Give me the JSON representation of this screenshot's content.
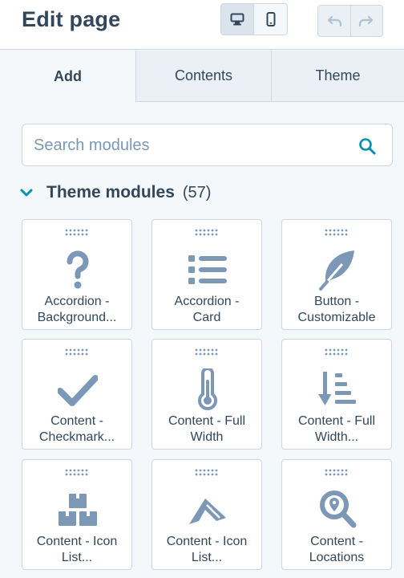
{
  "header": {
    "title": "Edit page",
    "view_toggle": [
      "desktop-icon",
      "mobile-icon"
    ],
    "history": [
      "undo-icon",
      "redo-icon"
    ]
  },
  "tabs": [
    {
      "label": "Add",
      "active": true
    },
    {
      "label": "Contents",
      "active": false
    },
    {
      "label": "Theme",
      "active": false
    }
  ],
  "search": {
    "placeholder": "Search modules",
    "icon": "search-icon"
  },
  "section": {
    "title": "Theme modules",
    "count": "(57)",
    "expanded": true
  },
  "modules": [
    {
      "line1": "Accordion -",
      "line2": "Background...",
      "icon": "question-mark-icon"
    },
    {
      "line1": "Accordion -",
      "line2": "Card",
      "icon": "list-icon"
    },
    {
      "line1": "Button -",
      "line2": "Customizable",
      "icon": "feather-icon"
    },
    {
      "line1": "Content -",
      "line2": "Checkmark...",
      "icon": "checkmark-icon"
    },
    {
      "line1": "Content - Full",
      "line2": "Width",
      "icon": "thermometer-icon"
    },
    {
      "line1": "Content - Full",
      "line2": "Width...",
      "icon": "sort-descending-icon"
    },
    {
      "line1": "Content - Icon",
      "line2": "List...",
      "icon": "boxes-icon"
    },
    {
      "line1": "Content - Icon",
      "line2": "List...",
      "icon": "brand-logo-icon"
    },
    {
      "line1": "Content -",
      "line2": "Locations",
      "icon": "magnifier-location-icon"
    }
  ],
  "colors": {
    "icon": "#7c98b6",
    "text": "#33475b",
    "accent": "#0091ae",
    "border": "#cbd6e2"
  }
}
